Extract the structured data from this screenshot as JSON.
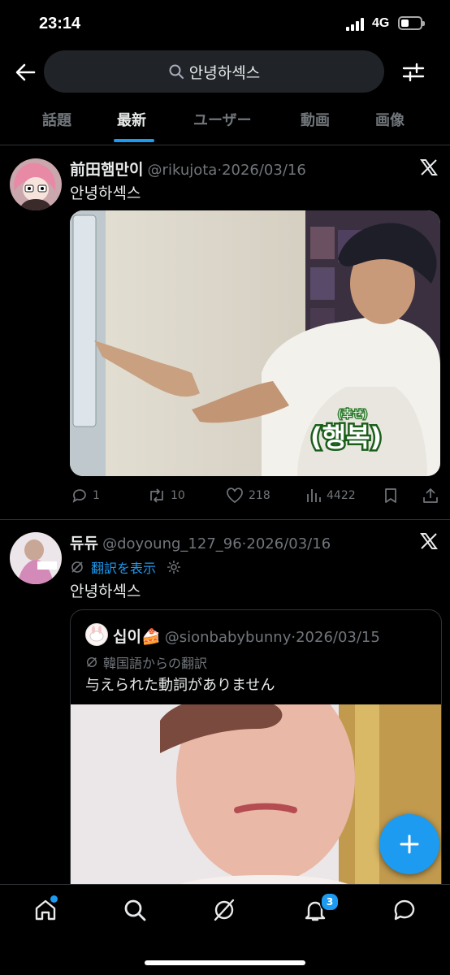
{
  "status_bar": {
    "time": "23:14",
    "network": "4G"
  },
  "search": {
    "query": "안녕하섹스"
  },
  "tabs": [
    {
      "label": "話題"
    },
    {
      "label": "最新"
    },
    {
      "label": "ユーザー"
    },
    {
      "label": "動画"
    },
    {
      "label": "画像"
    }
  ],
  "active_tab": "最新",
  "tweets": [
    {
      "name": "前田햄만이",
      "handle": "@rikujota",
      "date": "2026/03/16",
      "text": "안녕하섹스",
      "media_caption_small": "(幸せ)",
      "media_caption_large": "(행복)",
      "actions": {
        "replies": "1",
        "retweets": "10",
        "likes": "218",
        "views": "4422"
      }
    },
    {
      "name": "듀듀",
      "handle": "@doyoung_127_96",
      "date": "2026/03/16",
      "translate_link": "翻訳を表示",
      "text": "안녕하섹스",
      "quote": {
        "name": "십이🍰",
        "handle": "@sionbabybunny",
        "date": "2026/03/15",
        "translation_note": "韓国語からの翻訳",
        "text": "与えられた動詞がありません"
      }
    }
  ],
  "notifications_badge": "3",
  "colors": {
    "accent": "#1d9bf0",
    "background": "#000000",
    "secondary_text": "#71767b"
  }
}
